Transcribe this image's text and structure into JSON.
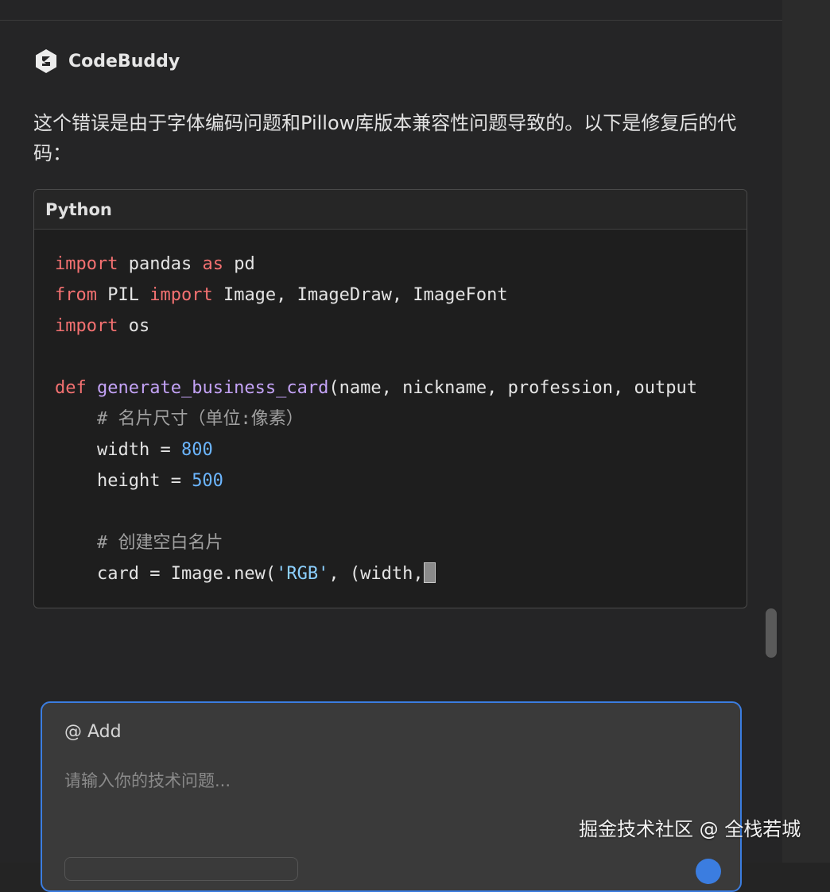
{
  "assistant": {
    "name": "CodeBuddy",
    "icon": "codebuddy-logo-icon"
  },
  "message": {
    "text": "这个错误是由于字体编码问题和Pillow库版本兼容性问题导致的。以下是修复后的代码："
  },
  "code_block": {
    "language": "Python",
    "lines": [
      [
        {
          "t": "import",
          "c": "kw"
        },
        {
          "t": " pandas "
        },
        {
          "t": "as",
          "c": "kw"
        },
        {
          "t": " pd"
        }
      ],
      [
        {
          "t": "from",
          "c": "kw"
        },
        {
          "t": " PIL "
        },
        {
          "t": "import",
          "c": "kw"
        },
        {
          "t": " Image, ImageDraw, ImageFont"
        }
      ],
      [
        {
          "t": "import",
          "c": "kw"
        },
        {
          "t": " os"
        }
      ],
      [],
      [
        {
          "t": "def",
          "c": "kw"
        },
        {
          "t": " "
        },
        {
          "t": "generate_business_card",
          "c": "fn"
        },
        {
          "t": "(name, nickname, profession, output"
        }
      ],
      [
        {
          "t": "    "
        },
        {
          "t": "# 名片尺寸（单位:像素）",
          "c": "cmt"
        }
      ],
      [
        {
          "t": "    width = "
        },
        {
          "t": "800",
          "c": "num"
        }
      ],
      [
        {
          "t": "    height = "
        },
        {
          "t": "500",
          "c": "num"
        }
      ],
      [],
      [
        {
          "t": "    "
        },
        {
          "t": "# 创建空白名片",
          "c": "cmt"
        }
      ],
      [
        {
          "t": "    card = Image.new("
        },
        {
          "t": "'RGB'",
          "c": "str"
        },
        {
          "t": ", (width,"
        }
      ]
    ]
  },
  "input": {
    "add_label": "@ Add",
    "placeholder": "请输入你的技术问题..."
  },
  "watermark": "掘金技术社区 @ 全栈若城",
  "colors": {
    "accent": "#3b7de0",
    "keyword": "#f47171",
    "function": "#c4a3f7",
    "number": "#6cb6ff",
    "string": "#8cd0ff"
  }
}
